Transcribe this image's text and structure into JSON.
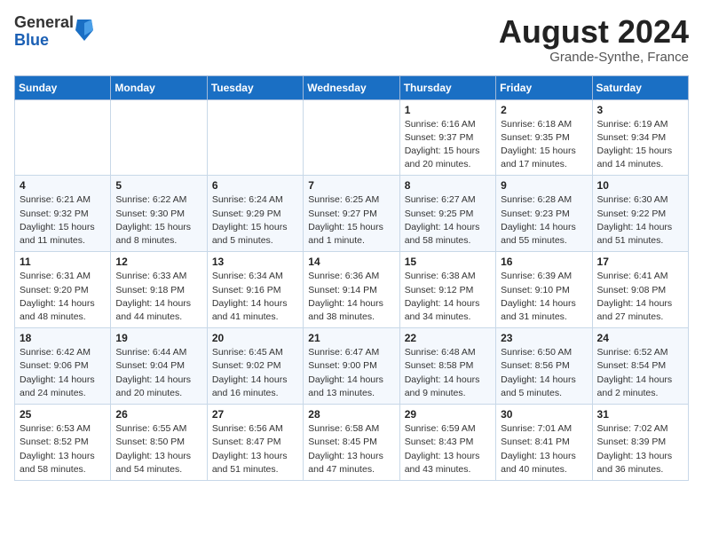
{
  "header": {
    "logo_general": "General",
    "logo_blue": "Blue",
    "month_title": "August 2024",
    "location": "Grande-Synthe, France"
  },
  "days_of_week": [
    "Sunday",
    "Monday",
    "Tuesday",
    "Wednesday",
    "Thursday",
    "Friday",
    "Saturday"
  ],
  "weeks": [
    [
      {
        "day": "",
        "info": ""
      },
      {
        "day": "",
        "info": ""
      },
      {
        "day": "",
        "info": ""
      },
      {
        "day": "",
        "info": ""
      },
      {
        "day": "1",
        "info": "Sunrise: 6:16 AM\nSunset: 9:37 PM\nDaylight: 15 hours\nand 20 minutes."
      },
      {
        "day": "2",
        "info": "Sunrise: 6:18 AM\nSunset: 9:35 PM\nDaylight: 15 hours\nand 17 minutes."
      },
      {
        "day": "3",
        "info": "Sunrise: 6:19 AM\nSunset: 9:34 PM\nDaylight: 15 hours\nand 14 minutes."
      }
    ],
    [
      {
        "day": "4",
        "info": "Sunrise: 6:21 AM\nSunset: 9:32 PM\nDaylight: 15 hours\nand 11 minutes."
      },
      {
        "day": "5",
        "info": "Sunrise: 6:22 AM\nSunset: 9:30 PM\nDaylight: 15 hours\nand 8 minutes."
      },
      {
        "day": "6",
        "info": "Sunrise: 6:24 AM\nSunset: 9:29 PM\nDaylight: 15 hours\nand 5 minutes."
      },
      {
        "day": "7",
        "info": "Sunrise: 6:25 AM\nSunset: 9:27 PM\nDaylight: 15 hours\nand 1 minute."
      },
      {
        "day": "8",
        "info": "Sunrise: 6:27 AM\nSunset: 9:25 PM\nDaylight: 14 hours\nand 58 minutes."
      },
      {
        "day": "9",
        "info": "Sunrise: 6:28 AM\nSunset: 9:23 PM\nDaylight: 14 hours\nand 55 minutes."
      },
      {
        "day": "10",
        "info": "Sunrise: 6:30 AM\nSunset: 9:22 PM\nDaylight: 14 hours\nand 51 minutes."
      }
    ],
    [
      {
        "day": "11",
        "info": "Sunrise: 6:31 AM\nSunset: 9:20 PM\nDaylight: 14 hours\nand 48 minutes."
      },
      {
        "day": "12",
        "info": "Sunrise: 6:33 AM\nSunset: 9:18 PM\nDaylight: 14 hours\nand 44 minutes."
      },
      {
        "day": "13",
        "info": "Sunrise: 6:34 AM\nSunset: 9:16 PM\nDaylight: 14 hours\nand 41 minutes."
      },
      {
        "day": "14",
        "info": "Sunrise: 6:36 AM\nSunset: 9:14 PM\nDaylight: 14 hours\nand 38 minutes."
      },
      {
        "day": "15",
        "info": "Sunrise: 6:38 AM\nSunset: 9:12 PM\nDaylight: 14 hours\nand 34 minutes."
      },
      {
        "day": "16",
        "info": "Sunrise: 6:39 AM\nSunset: 9:10 PM\nDaylight: 14 hours\nand 31 minutes."
      },
      {
        "day": "17",
        "info": "Sunrise: 6:41 AM\nSunset: 9:08 PM\nDaylight: 14 hours\nand 27 minutes."
      }
    ],
    [
      {
        "day": "18",
        "info": "Sunrise: 6:42 AM\nSunset: 9:06 PM\nDaylight: 14 hours\nand 24 minutes."
      },
      {
        "day": "19",
        "info": "Sunrise: 6:44 AM\nSunset: 9:04 PM\nDaylight: 14 hours\nand 20 minutes."
      },
      {
        "day": "20",
        "info": "Sunrise: 6:45 AM\nSunset: 9:02 PM\nDaylight: 14 hours\nand 16 minutes."
      },
      {
        "day": "21",
        "info": "Sunrise: 6:47 AM\nSunset: 9:00 PM\nDaylight: 14 hours\nand 13 minutes."
      },
      {
        "day": "22",
        "info": "Sunrise: 6:48 AM\nSunset: 8:58 PM\nDaylight: 14 hours\nand 9 minutes."
      },
      {
        "day": "23",
        "info": "Sunrise: 6:50 AM\nSunset: 8:56 PM\nDaylight: 14 hours\nand 5 minutes."
      },
      {
        "day": "24",
        "info": "Sunrise: 6:52 AM\nSunset: 8:54 PM\nDaylight: 14 hours\nand 2 minutes."
      }
    ],
    [
      {
        "day": "25",
        "info": "Sunrise: 6:53 AM\nSunset: 8:52 PM\nDaylight: 13 hours\nand 58 minutes."
      },
      {
        "day": "26",
        "info": "Sunrise: 6:55 AM\nSunset: 8:50 PM\nDaylight: 13 hours\nand 54 minutes."
      },
      {
        "day": "27",
        "info": "Sunrise: 6:56 AM\nSunset: 8:47 PM\nDaylight: 13 hours\nand 51 minutes."
      },
      {
        "day": "28",
        "info": "Sunrise: 6:58 AM\nSunset: 8:45 PM\nDaylight: 13 hours\nand 47 minutes."
      },
      {
        "day": "29",
        "info": "Sunrise: 6:59 AM\nSunset: 8:43 PM\nDaylight: 13 hours\nand 43 minutes."
      },
      {
        "day": "30",
        "info": "Sunrise: 7:01 AM\nSunset: 8:41 PM\nDaylight: 13 hours\nand 40 minutes."
      },
      {
        "day": "31",
        "info": "Sunrise: 7:02 AM\nSunset: 8:39 PM\nDaylight: 13 hours\nand 36 minutes."
      }
    ]
  ]
}
